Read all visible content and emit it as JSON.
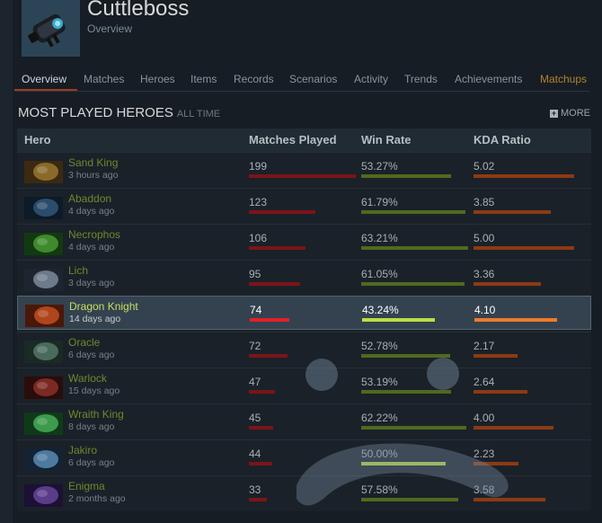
{
  "player": {
    "name": "Cuttleboss",
    "subtitle": "Overview"
  },
  "tabs": [
    {
      "label": "Overview",
      "active": true
    },
    {
      "label": "Matches"
    },
    {
      "label": "Heroes"
    },
    {
      "label": "Items"
    },
    {
      "label": "Records"
    },
    {
      "label": "Scenarios"
    },
    {
      "label": "Activity"
    },
    {
      "label": "Trends"
    },
    {
      "label": "Achievements"
    },
    {
      "label": "Matchups"
    }
  ],
  "section": {
    "title": "MOST PLAYED HEROES",
    "subtitle": "ALL TIME",
    "more_label": "MORE"
  },
  "columns": {
    "hero": "Hero",
    "matches": "Matches Played",
    "winrate": "Win Rate",
    "kda": "KDA Ratio"
  },
  "colors": {
    "accent": "#a23b1e",
    "hero_link": "#6b8a2c",
    "matchups_tab": "#b2822c"
  },
  "rows": [
    {
      "name": "Sand King",
      "time": "3 hours ago",
      "matches": "199",
      "winrate": "53.27%",
      "kda": "5.02",
      "matches_frac": 1.0,
      "winrate_frac": 0.5327,
      "kda_frac": 0.94
    },
    {
      "name": "Abaddon",
      "time": "4 days ago",
      "matches": "123",
      "winrate": "61.79%",
      "kda": "3.85",
      "matches_frac": 0.62,
      "winrate_frac": 0.6179,
      "kda_frac": 0.72
    },
    {
      "name": "Necrophos",
      "time": "4 days ago",
      "matches": "106",
      "winrate": "63.21%",
      "kda": "5.00",
      "matches_frac": 0.53,
      "winrate_frac": 0.6321,
      "kda_frac": 0.94
    },
    {
      "name": "Lich",
      "time": "3 days ago",
      "matches": "95",
      "winrate": "61.05%",
      "kda": "3.36",
      "matches_frac": 0.48,
      "winrate_frac": 0.6105,
      "kda_frac": 0.63
    },
    {
      "name": "Dragon Knight",
      "time": "14 days ago",
      "matches": "74",
      "winrate": "43.24%",
      "kda": "4.10",
      "matches_frac": 0.37,
      "winrate_frac": 0.4324,
      "kda_frac": 0.77,
      "highlight": true
    },
    {
      "name": "Oracle",
      "time": "6 days ago",
      "matches": "72",
      "winrate": "52.78%",
      "kda": "2.17",
      "matches_frac": 0.36,
      "winrate_frac": 0.5278,
      "kda_frac": 0.41
    },
    {
      "name": "Warlock",
      "time": "15 days ago",
      "matches": "47",
      "winrate": "53.19%",
      "kda": "2.64",
      "matches_frac": 0.24,
      "winrate_frac": 0.5319,
      "kda_frac": 0.5
    },
    {
      "name": "Wraith King",
      "time": "8 days ago",
      "matches": "45",
      "winrate": "62.22%",
      "kda": "4.00",
      "matches_frac": 0.23,
      "winrate_frac": 0.6222,
      "kda_frac": 0.75
    },
    {
      "name": "Jakiro",
      "time": "6 days ago",
      "matches": "44",
      "winrate": "50.00%",
      "kda": "2.23",
      "matches_frac": 0.22,
      "winrate_frac": 0.5,
      "kda_frac": 0.42,
      "bright_winrate": true
    },
    {
      "name": "Enigma",
      "time": "2 months ago",
      "matches": "33",
      "winrate": "57.58%",
      "kda": "3.58",
      "matches_frac": 0.17,
      "winrate_frac": 0.5758,
      "kda_frac": 0.67
    }
  ]
}
